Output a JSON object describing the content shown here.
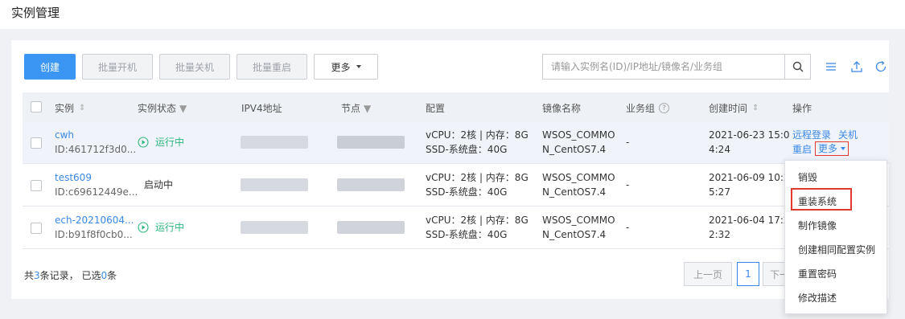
{
  "page": {
    "title": "实例管理"
  },
  "toolbar": {
    "create": "创建",
    "batch_start": "批量开机",
    "batch_stop": "批量关机",
    "batch_restart": "批量重启",
    "more": "更多"
  },
  "search": {
    "placeholder": "请输入实例名(ID)/IP地址/镜像名/业务组",
    "value": ""
  },
  "tool_icons": [
    "search-icon",
    "list-settings-icon",
    "upload-icon",
    "refresh-icon"
  ],
  "table": {
    "headers": {
      "instance": "实例",
      "status": "实例状态",
      "ipv4": "IPV4地址",
      "node": "节点",
      "config": "配置",
      "image": "镜像名称",
      "group": "业务组",
      "created": "创建时间",
      "actions": "操作"
    },
    "rows": [
      {
        "name": "cwh",
        "id": "ID:461712f3d0...",
        "status": "运行中",
        "status_running": true,
        "config_line1": "vCPU：2核 | 内存：8G",
        "config_line2": "SSD-系统盘：40G",
        "image_line1": "WSOS_COMMO",
        "image_line2": "N_CentOS7.4",
        "group": "-",
        "created_line1": "2021-06-23 15:0",
        "created_line2": "4:24",
        "actions": {
          "remote_login": "远程登录",
          "shutdown": "关机",
          "restart": "重启",
          "more": "更多"
        }
      },
      {
        "name": "test609",
        "id": "ID:c69612449e...",
        "status": "启动中",
        "status_running": false,
        "config_line1": "vCPU：2核 | 内存：8G",
        "config_line2": "SSD-系统盘：40G",
        "image_line1": "WSOS_COMMO",
        "image_line2": "N_CentOS7.4",
        "group": "-",
        "created_line1": "2021-06-09 10:2",
        "created_line2": "5:27"
      },
      {
        "name": "ech-20210604...",
        "id": "ID:b91f8f0cb0...",
        "status": "运行中",
        "status_running": true,
        "config_line1": "vCPU：2核 | 内存：8G",
        "config_line2": "SSD-系统盘：40G",
        "image_line1": "WSOS_COMMO",
        "image_line2": "N_CentOS7.4",
        "group": "-",
        "created_line1": "2021-06-04 17:2",
        "created_line2": "2:32"
      }
    ]
  },
  "footer": {
    "prefix": "共",
    "total": "3",
    "mid": "条记录， 已选",
    "selected": "0",
    "suffix": "条"
  },
  "pager": {
    "prev": "上一页",
    "page": "1",
    "next": "下一"
  },
  "dropdown": {
    "items": [
      "销毁",
      "重装系统",
      "制作镜像",
      "创建相同配置实例",
      "重置密码",
      "修改描述"
    ]
  },
  "colors": {
    "primary": "#3a96f2",
    "link": "#3a88e6",
    "running": "#2fb57c",
    "highlight_box": "#e23a2f"
  }
}
